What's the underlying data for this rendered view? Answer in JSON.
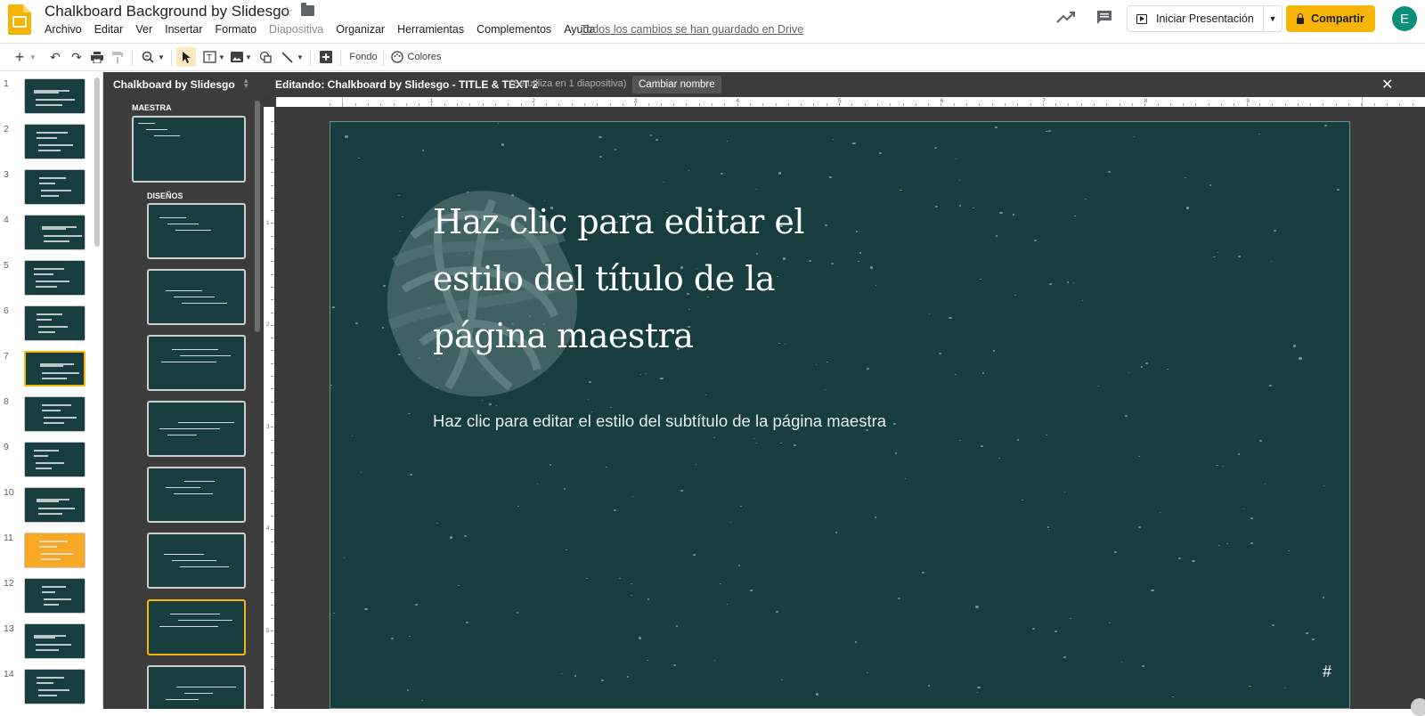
{
  "app": {
    "title": "Chalkboard Background by Slidesgo",
    "save_status": "Todos los cambios se han guardado en Drive",
    "menu": [
      "Archivo",
      "Editar",
      "Ver",
      "Insertar",
      "Formato",
      "Diapositiva",
      "Organizar",
      "Herramientas",
      "Complementos",
      "Ayuda"
    ],
    "present_label": "Iniciar Presentación",
    "share_label": "Compartir",
    "avatar_letter": "E",
    "share_color": "#f9b408"
  },
  "toolbar": {
    "fondo_label": "Fondo",
    "colores_label": "Colores"
  },
  "filmstrip": {
    "slides": [
      "1",
      "2",
      "3",
      "4",
      "5",
      "6",
      "7",
      "8",
      "9",
      "10",
      "11",
      "12",
      "13",
      "14"
    ],
    "selected": "7"
  },
  "layouts": {
    "panel_title": "Chalkboard by Slidesgo",
    "master_label": "MAESTRA",
    "designs_label": "DISEÑOS"
  },
  "editor": {
    "editing_label": "Editando: Chalkboard by Slidesgo - TITLE & TEXT 2",
    "usage_label": "(Se utiliza en 1 diapositiva)",
    "rename_label": "Cambiar nombre",
    "ruler_numbers": [
      "1",
      "2",
      "3",
      "4",
      "5",
      "6",
      "7",
      "8",
      "9"
    ],
    "vruler_numbers": [
      "1",
      "2",
      "3",
      "4",
      "5"
    ]
  },
  "slide": {
    "title_line1": "Haz clic para editar el",
    "title_line2": "estilo del título de la",
    "title_line3": "página maestra",
    "subtitle": "Haz clic para editar el estilo del subtítulo de la página maestra",
    "number_placeholder": "#",
    "background_color": "#173d3f"
  }
}
